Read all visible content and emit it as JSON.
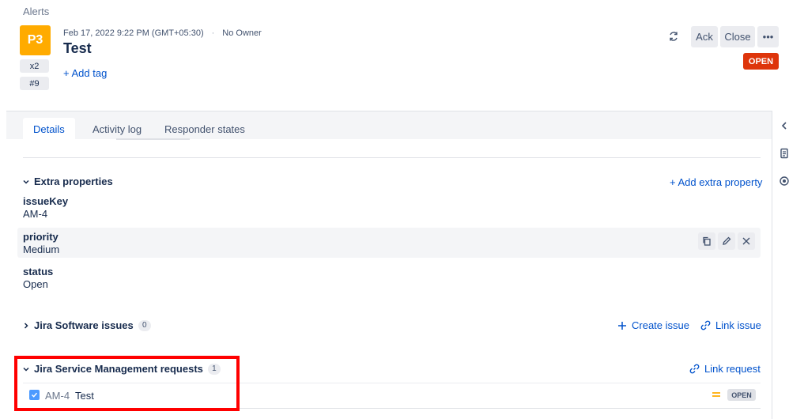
{
  "breadcrumb": "Alerts",
  "alert": {
    "priority": "P3",
    "count": "x2",
    "tiny_id": "#9",
    "created": "Feb 17, 2022 9:22 PM (GMT+05:30)",
    "owner": "No Owner",
    "title": "Test",
    "add_tag": "+ Add tag",
    "status": "OPEN"
  },
  "actions": {
    "ack": "Ack",
    "close": "Close",
    "more": "•••"
  },
  "tabs": [
    {
      "label": "Details",
      "active": true
    },
    {
      "label": "Activity log",
      "active": false
    },
    {
      "label": "Responder states",
      "active": false
    }
  ],
  "extra_properties": {
    "heading": "Extra properties",
    "add_label": "+ Add extra property",
    "items": [
      {
        "key": "issueKey",
        "value": "AM-4"
      },
      {
        "key": "priority",
        "value": "Medium"
      },
      {
        "key": "status",
        "value": "Open"
      }
    ]
  },
  "jira_software": {
    "heading": "Jira Software issues",
    "count": "0",
    "create_label": "Create issue",
    "link_label": "Link issue"
  },
  "jsm": {
    "heading": "Jira Service Management requests",
    "count": "1",
    "link_label": "Link request",
    "requests": [
      {
        "key": "AM-4",
        "title": "Test",
        "status": "OPEN",
        "priority": "Medium"
      }
    ]
  },
  "colors": {
    "priority_badge": "#ffab00",
    "open_badge": "#de350b",
    "link": "#0052cc",
    "highlight": "#ff0000"
  },
  "icons": {
    "refresh": "refresh-icon",
    "copy": "copy-icon",
    "edit": "pencil-icon",
    "delete": "close-icon",
    "plus": "plus-icon",
    "link": "link-icon",
    "chevron": "chevron-down-icon",
    "chevron_right": "chevron-right-icon",
    "priority_medium": "priority-medium-icon"
  }
}
